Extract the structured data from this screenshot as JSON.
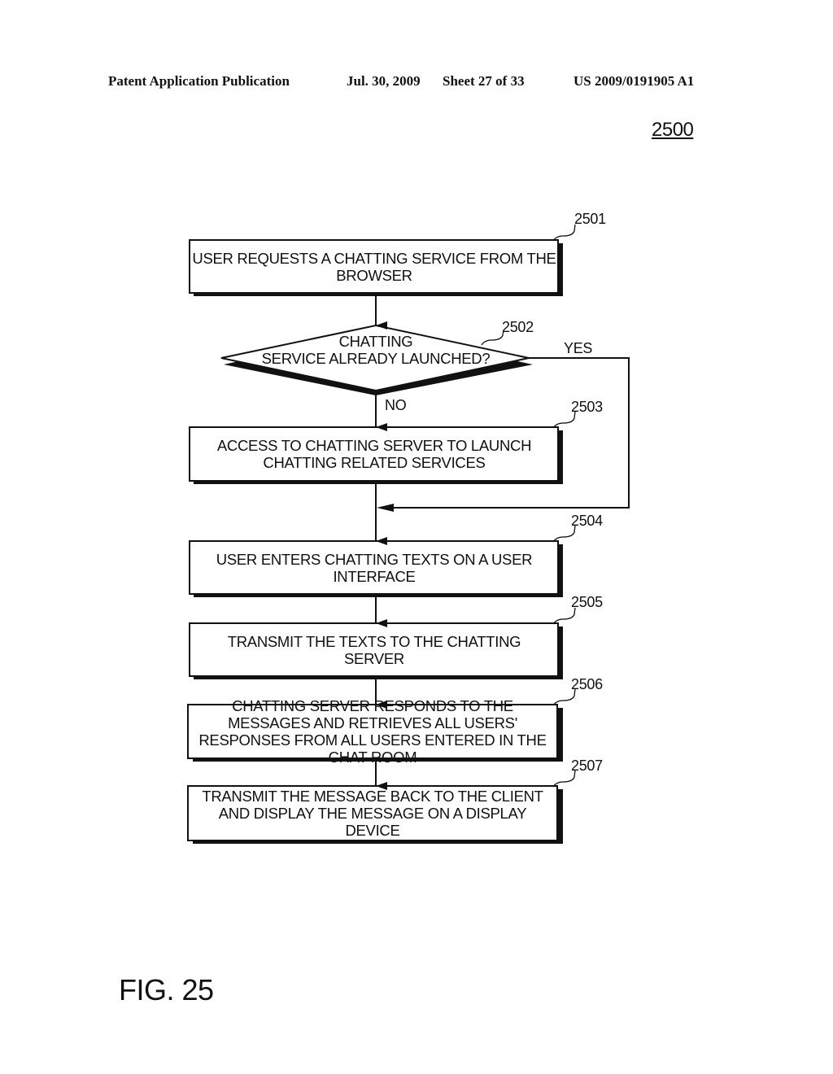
{
  "header": {
    "publication": "Patent Application Publication",
    "date": "Jul. 30, 2009",
    "sheet": "Sheet 27 of 33",
    "patent_number": "US 2009/0191905 A1"
  },
  "figure_ref": "2500",
  "flowchart": {
    "steps": [
      {
        "ref": "2501",
        "type": "process",
        "text": "USER REQUESTS A CHATTING SERVICE FROM THE BROWSER"
      },
      {
        "ref": "2502",
        "type": "decision",
        "text": "CHATTING SERVICE ALREADY LAUNCHED?"
      },
      {
        "ref": "2503",
        "type": "process",
        "text": "ACCESS TO CHATTING SERVER TO LAUNCH CHATTING RELATED SERVICES"
      },
      {
        "ref": "2504",
        "type": "process",
        "text": "USER ENTERS CHATTING TEXTS ON A USER INTERFACE"
      },
      {
        "ref": "2505",
        "type": "process",
        "text": "TRANSMIT THE TEXTS TO THE CHATTING SERVER"
      },
      {
        "ref": "2506",
        "type": "process",
        "text": "CHATTING SERVER RESPONDS TO THE MESSAGES AND RETRIEVES ALL USERS' RESPONSES FROM ALL USERS ENTERED IN THE CHAT ROOM"
      },
      {
        "ref": "2507",
        "type": "process",
        "text": "TRANSMIT THE MESSAGE BACK TO THE CLIENT AND DISPLAY THE MESSAGE ON A DISPLAY DEVICE"
      }
    ],
    "decision_labels": {
      "yes": "YES",
      "no": "NO"
    },
    "decision_lines": [
      "CHATTING",
      "SERVICE ALREADY LAUNCHED?"
    ]
  },
  "caption": "FIG. 25"
}
